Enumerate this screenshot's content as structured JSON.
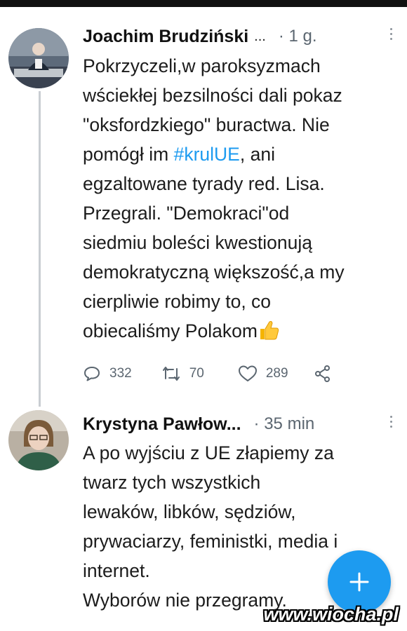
{
  "tweets": [
    {
      "author": "Joachim Brudziński",
      "ellipsis": "...",
      "time": "· 1 g.",
      "lines": [
        [
          "Pokrzyczeli,w paroksyzmach"
        ],
        [
          "wściekłej bezsilności dali pokaz"
        ],
        [
          "\"oksfordzkiego\" buractwa. Nie"
        ],
        [
          "pomógł im ",
          "#krulUE",
          ", ani"
        ],
        [
          "egzaltowane tyrady red. Lisa."
        ],
        [
          "Przegrali. \"Demokraci\"od"
        ],
        [
          "siedmiu boleści kwestionują"
        ],
        [
          "demokratyczną większość,a my"
        ],
        [
          "cierpliwie robimy to, co"
        ],
        [
          "obiecaliśmy Polakom"
        ]
      ],
      "emoji_icon": "thumbs-up-emoji",
      "stats": {
        "replies": "332",
        "retweets": "70",
        "likes": "289"
      }
    },
    {
      "author": "Krystyna Pawłow...",
      "time": "· 35 min",
      "lines": [
        "A po wyjściu z UE złapiemy za",
        "twarz tych wszystkich",
        "lewaków, libków, sędziów,",
        "prywaciarzy, feministki, media i",
        "internet.",
        "Wyborów nie przegramy."
      ]
    }
  ],
  "fab": {
    "icon": "plus-icon",
    "color": "#1d9bf0"
  },
  "watermark": "www.wiocha.pl",
  "colors": {
    "hashtag": "#1d9bf0",
    "secondary_text": "#5b6670",
    "thread_line": "#c9cdd2"
  }
}
